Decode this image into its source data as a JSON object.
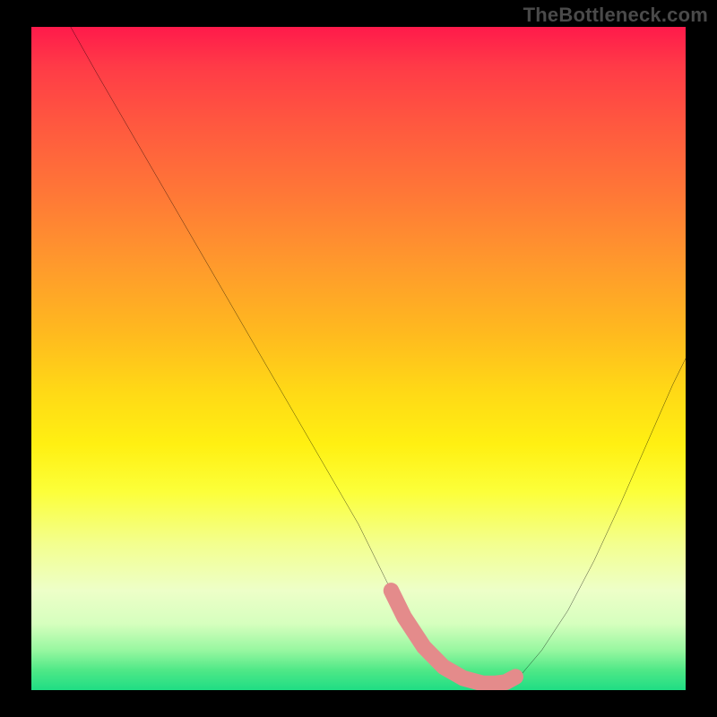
{
  "watermark": "TheBottleneck.com",
  "chart_data": {
    "type": "line",
    "title": "",
    "xlabel": "",
    "ylabel": "",
    "xlim": [
      0,
      100
    ],
    "ylim": [
      0,
      100
    ],
    "grid": false,
    "series": [
      {
        "name": "bottleneck-curve",
        "x": [
          6,
          10,
          15,
          20,
          25,
          30,
          35,
          40,
          45,
          50,
          53,
          55,
          57,
          60,
          63,
          66,
          69,
          71,
          72.5,
          75,
          78,
          82,
          86,
          90,
          94,
          98,
          100
        ],
        "y": [
          100,
          93,
          84.5,
          76,
          67.5,
          59,
          50.5,
          42,
          33.5,
          25,
          19,
          15,
          11,
          6.5,
          3.5,
          1.8,
          1.0,
          1.0,
          1.2,
          2.5,
          6,
          12,
          19.5,
          28,
          37,
          46,
          50
        ]
      }
    ],
    "highlight_band": {
      "name": "optimum-range",
      "color": "#e48b8b",
      "x": [
        55,
        57,
        60,
        63,
        66,
        69,
        71,
        72.5,
        74
      ],
      "y": [
        15,
        11,
        6.5,
        3.5,
        1.8,
        1.0,
        1.0,
        1.2,
        2.0
      ]
    },
    "colors": {
      "curve": "#000000",
      "highlight": "#e48b8b",
      "frame": "#000000"
    }
  }
}
